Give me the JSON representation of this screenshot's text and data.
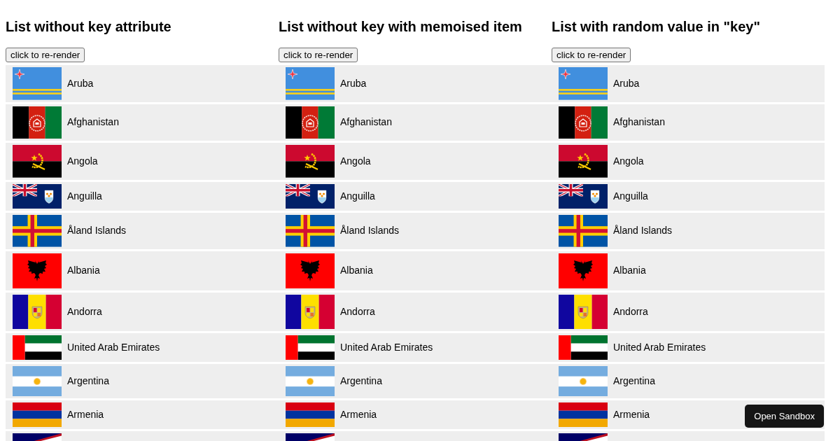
{
  "columns": [
    {
      "title": "List without key attribute",
      "button": "click to re-render",
      "items": [
        {
          "kind": "aruba",
          "name": "Aruba"
        },
        {
          "kind": "afghanistan",
          "name": "Afghanistan"
        },
        {
          "kind": "angola",
          "name": "Angola"
        },
        {
          "kind": "anguilla",
          "name": "Anguilla"
        },
        {
          "kind": "aland",
          "name": "Åland Islands"
        },
        {
          "kind": "albania",
          "name": "Albania"
        },
        {
          "kind": "andorra",
          "name": "Andorra"
        },
        {
          "kind": "uae",
          "name": "United Arab Emirates"
        },
        {
          "kind": "argentina",
          "name": "Argentina"
        },
        {
          "kind": "armenia",
          "name": "Armenia"
        },
        {
          "kind": "american-samoa"
        }
      ]
    },
    {
      "title": "List without key with memoised item",
      "button": "click to re-render",
      "items": [
        {
          "kind": "aruba",
          "name": "Aruba"
        },
        {
          "kind": "afghanistan",
          "name": "Afghanistan"
        },
        {
          "kind": "angola",
          "name": "Angola"
        },
        {
          "kind": "anguilla",
          "name": "Anguilla"
        },
        {
          "kind": "aland",
          "name": "Åland Islands"
        },
        {
          "kind": "albania",
          "name": "Albania"
        },
        {
          "kind": "andorra",
          "name": "Andorra"
        },
        {
          "kind": "uae",
          "name": "United Arab Emirates"
        },
        {
          "kind": "argentina",
          "name": "Argentina"
        },
        {
          "kind": "armenia",
          "name": "Armenia"
        },
        {
          "kind": "american-samoa"
        }
      ]
    },
    {
      "title": "List with random value in \"key\"",
      "button": "click to re-render",
      "items": [
        {
          "kind": "aruba",
          "name": "Aruba"
        },
        {
          "kind": "afghanistan",
          "name": "Afghanistan"
        },
        {
          "kind": "angola",
          "name": "Angola"
        },
        {
          "kind": "anguilla",
          "name": "Anguilla"
        },
        {
          "kind": "aland",
          "name": "Åland Islands"
        },
        {
          "kind": "albania",
          "name": "Albania"
        },
        {
          "kind": "andorra",
          "name": "Andorra"
        },
        {
          "kind": "uae",
          "name": "United Arab Emirates"
        },
        {
          "kind": "argentina",
          "name": "Argentina"
        },
        {
          "kind": "armenia",
          "name": "Armenia"
        },
        {
          "kind": "american-samoa"
        }
      ]
    }
  ],
  "sandbox_button": "Open Sandbox"
}
